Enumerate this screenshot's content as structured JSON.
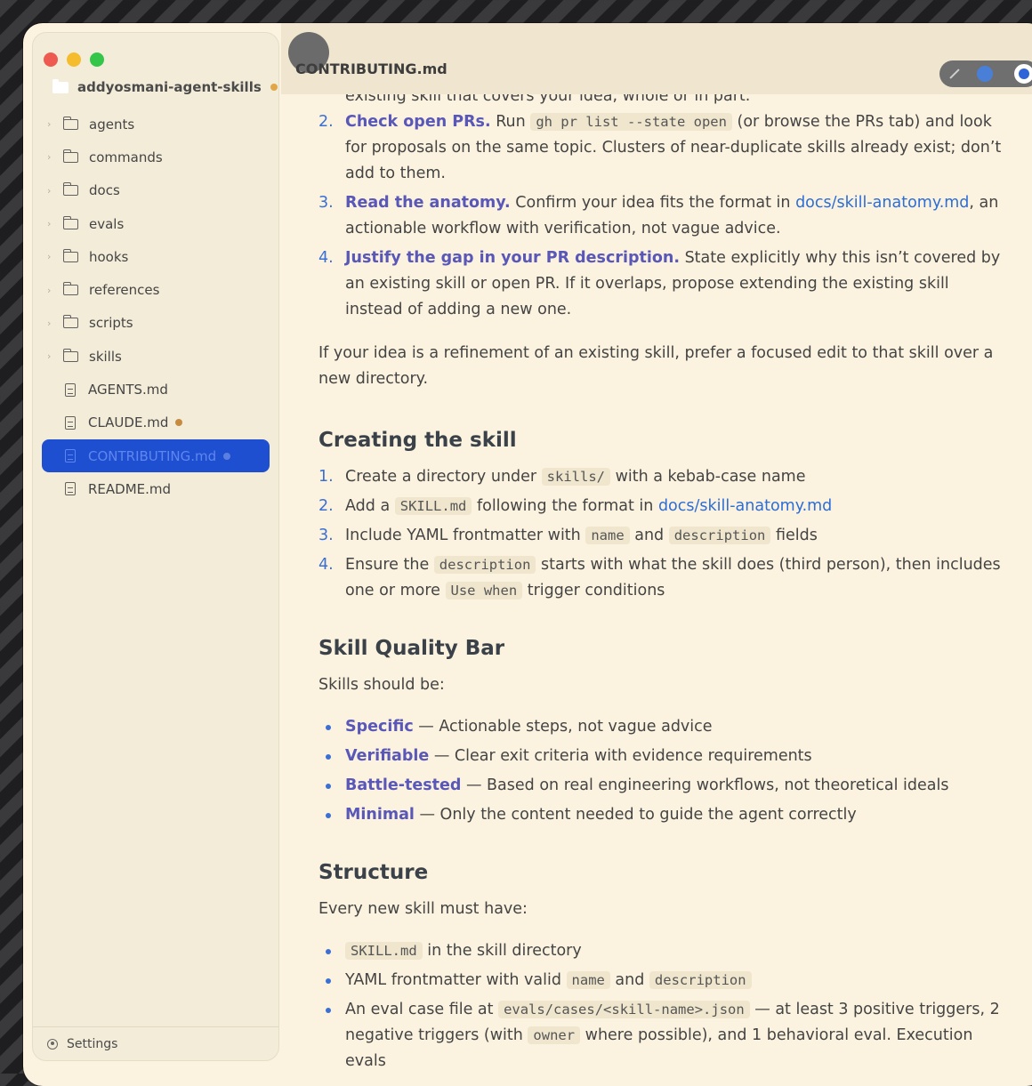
{
  "sidebar": {
    "root": "addyosmani-agent-skills",
    "items": [
      {
        "label": "agents",
        "type": "folder"
      },
      {
        "label": "commands",
        "type": "folder"
      },
      {
        "label": "docs",
        "type": "folder"
      },
      {
        "label": "evals",
        "type": "folder"
      },
      {
        "label": "hooks",
        "type": "folder"
      },
      {
        "label": "references",
        "type": "folder"
      },
      {
        "label": "scripts",
        "type": "folder"
      },
      {
        "label": "skills",
        "type": "folder"
      },
      {
        "label": "AGENTS.md",
        "type": "file"
      },
      {
        "label": "CLAUDE.md",
        "type": "file",
        "modified": true
      },
      {
        "label": "CONTRIBUTING.md",
        "type": "file",
        "selected": true,
        "modified": true
      },
      {
        "label": "README.md",
        "type": "file"
      }
    ],
    "settings": "Settings"
  },
  "header": {
    "title": "CONTRIBUTING.md",
    "tools": [
      "pencil-icon",
      "color-dot-icon",
      "toggle-icon"
    ]
  },
  "doc": {
    "partial_line": "existing skill that covers your idea, whole or in part.",
    "steps": [
      {
        "num": "2.",
        "lead": "Check open PRs.",
        "t1": " Run ",
        "code": "gh pr list --state open",
        "t2": " (or browse the PRs tab) and look for proposals on the same topic. Clusters of near-duplicate skills already exist; don’t add to them."
      },
      {
        "num": "3.",
        "lead": "Read the anatomy.",
        "t1": " Confirm your idea fits the format in ",
        "link": "docs/skill-anatomy.md",
        "t2": ", an actionable workflow with verification, not vague advice."
      },
      {
        "num": "4.",
        "lead": "Justify the gap in your PR description.",
        "t1": " State explicitly why this isn’t covered by an existing skill or open PR. If it overlaps, propose extending the existing skill instead of adding a new one."
      }
    ],
    "refinement": "If your idea is a refinement of an existing skill, prefer a focused edit to that skill over a new directory.",
    "creating": {
      "heading": "Creating the skill",
      "steps": [
        {
          "num": "1.",
          "a": "Create a directory under ",
          "code": "skills/",
          "b": " with a kebab-case name"
        },
        {
          "num": "2.",
          "a": "Add a ",
          "code": "SKILL.md",
          "b": " following the format in ",
          "link": "docs/skill-anatomy.md"
        },
        {
          "num": "3.",
          "a": "Include YAML frontmatter with ",
          "code1": "name",
          "mid": " and ",
          "code2": "description",
          "b": " fields"
        },
        {
          "num": "4.",
          "a": "Ensure the ",
          "code1": "description",
          "mid": " starts with what the skill does (third person), then includes one or more ",
          "code2": "Use when",
          "b": " trigger conditions"
        }
      ]
    },
    "quality": {
      "heading": "Skill Quality Bar",
      "intro": "Skills should be:",
      "items": [
        {
          "term": "Specific",
          "desc": " — Actionable steps, not vague advice"
        },
        {
          "term": "Verifiable",
          "desc": " — Clear exit criteria with evidence requirements"
        },
        {
          "term": "Battle-tested",
          "desc": " — Based on real engineering workflows, not theoretical ideals"
        },
        {
          "term": "Minimal",
          "desc": " — Only the content needed to guide the agent correctly"
        }
      ]
    },
    "structure": {
      "heading": "Structure",
      "intro": "Every new skill must have:",
      "items": [
        {
          "code": "SKILL.md",
          "text": " in the skill directory"
        },
        {
          "a": "YAML frontmatter with valid ",
          "code1": "name",
          "mid": " and ",
          "code2": "description"
        },
        {
          "a": "An eval case file at ",
          "code1": "evals/cases/<skill-name>.json",
          "mid": " — at least 3 positive triggers, 2 negative triggers (with ",
          "code2": "owner",
          "b": " where possible), and 1 behavioral eval. Execution evals"
        }
      ]
    }
  }
}
